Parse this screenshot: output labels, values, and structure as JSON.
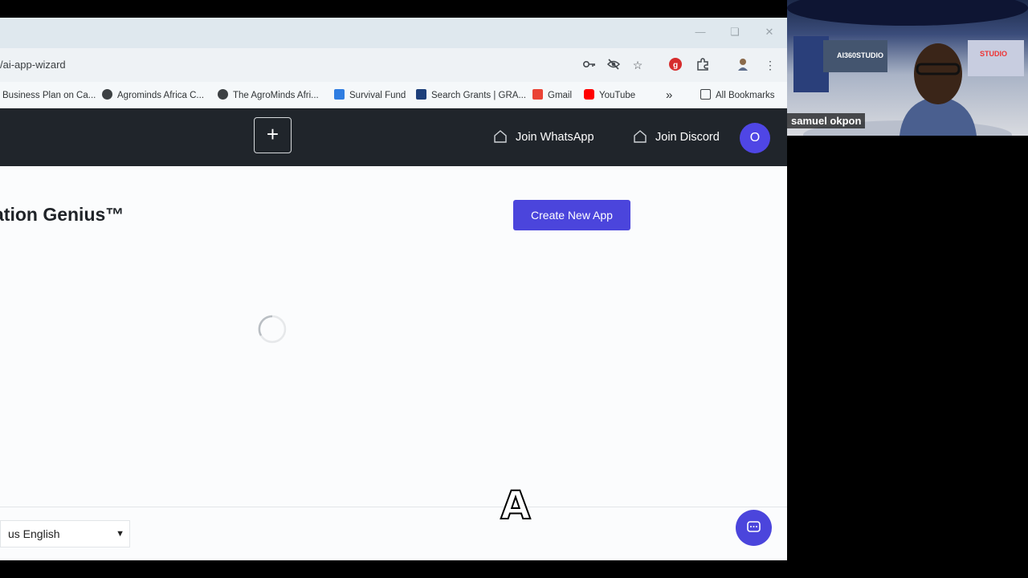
{
  "browser": {
    "url": "/ai-app-wizard",
    "bookmarks": [
      {
        "label": "Business Plan on Ca...",
        "icon": "none"
      },
      {
        "label": "Agrominds Africa C...",
        "icon": "globe-icon"
      },
      {
        "label": "The AgroMinds Afri...",
        "icon": "globe-icon"
      },
      {
        "label": "Survival Fund",
        "icon": "survival-fund-icon"
      },
      {
        "label": "Search Grants | GRA...",
        "icon": "grants-icon"
      },
      {
        "label": "Gmail",
        "icon": "gmail-icon"
      },
      {
        "label": "YouTube",
        "icon": "youtube-icon"
      }
    ],
    "overflow_label": "»",
    "all_bookmarks_label": "All Bookmarks"
  },
  "header": {
    "plus_label": "+",
    "whatsapp_label": "Join WhatsApp",
    "discord_label": "Join Discord",
    "avatar_initial": "O"
  },
  "main": {
    "title": "ation Genius™",
    "create_button_label": "Create New App",
    "loading": true
  },
  "footer": {
    "language_selected": "us English"
  },
  "caption": {
    "text": "A"
  },
  "webcam": {
    "participant_name": "samuel okpon",
    "background_logo": "AI360STUDIO",
    "background_text_right": "STUDIO"
  },
  "colors": {
    "accent": "#4b45dc",
    "header_bg": "#20252b"
  }
}
